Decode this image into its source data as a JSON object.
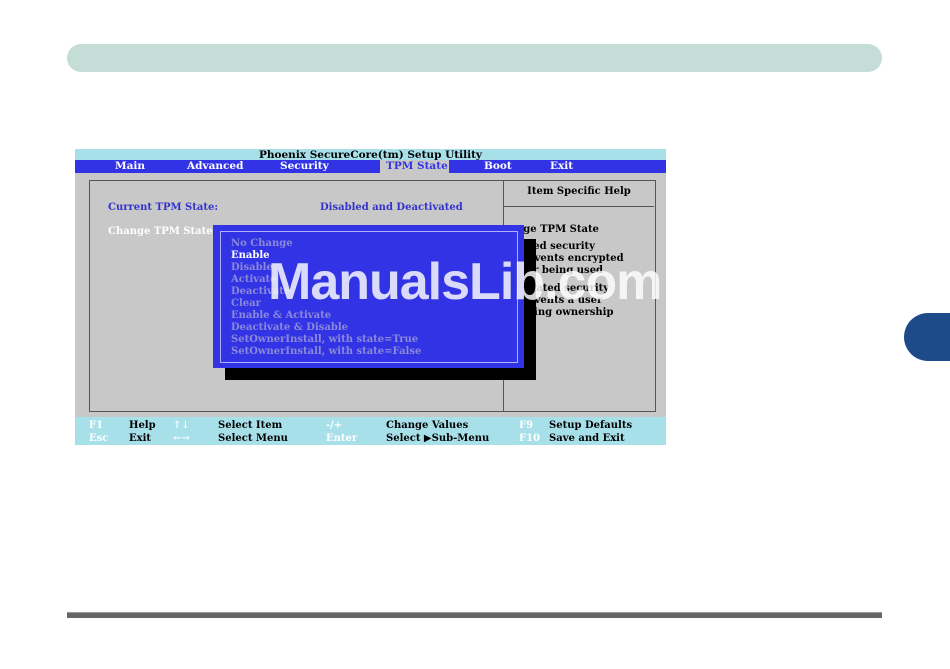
{
  "bios": {
    "title": "Phoenix SecureCore(tm) Setup Utility",
    "menu": [
      "Main",
      "Advanced",
      "Security",
      "TPM State",
      "Boot",
      "Exit"
    ],
    "active_menu": "TPM State",
    "current_tpm_label": "Current TPM State:",
    "current_tpm_value": "Disabled and Deactivated",
    "change_tpm_label": "Change TPM State",
    "help_title": "Item Specific Help",
    "help_lines": [
      "nge TPM State",
      "abled security",
      "prevents encrypted",
      "d or being used",
      "ctivated security",
      "prevents a user",
      "taking ownership"
    ],
    "popup_options": [
      "No Change",
      "Enable",
      "Disable",
      "Activate",
      "Deactivate",
      "Clear",
      "Enable & Activate",
      "Deactivate & Disable",
      "SetOwnerInstall, with state=True",
      "SetOwnerInstall, with state=False"
    ],
    "popup_selected": "Enable",
    "status_keys": {
      "f1_key": "F1",
      "f1_label": "Help",
      "updown_key": "↑↓",
      "updown_label": "Select Item",
      "plusminus_key": "-/+",
      "plusminus_label": "Change Values",
      "f9_key": "F9",
      "f9_label": "Setup Defaults",
      "esc_key": "Esc",
      "esc_label": "Exit",
      "leftright_key": "←→",
      "leftright_label": "Select Menu",
      "enter_key": "Enter",
      "enter_label": "Select ▶Sub-Menu",
      "f10_key": "F10",
      "f10_label": "Save and Exit"
    }
  },
  "watermark": "ManualsLib.com",
  "colors": {
    "menubar": "#3333e6",
    "title_bar": "#a8e0ea",
    "bios_bg": "#c8c8c8",
    "header_bar": "#c5ddd7",
    "chapter_tab": "#1f4a8a"
  }
}
